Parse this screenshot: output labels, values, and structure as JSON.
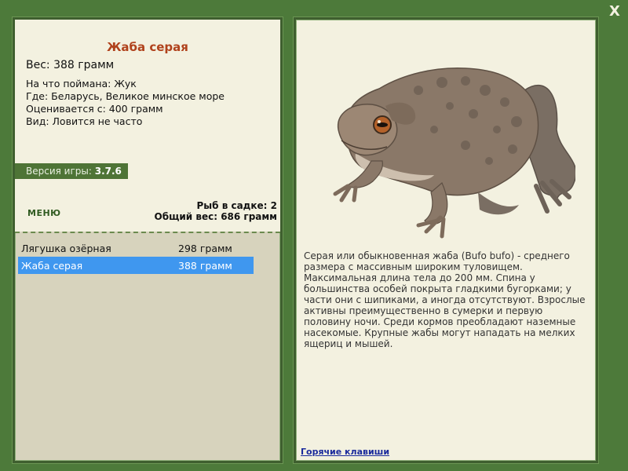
{
  "fish": {
    "title": "Жаба серая",
    "weight": "Вес: 388 грамм",
    "bait": "На что поймана: Жук",
    "location": "Где: Беларусь, Великое минское море",
    "value": "Оценивается с: 400 грамм",
    "rarity": "Вид: Ловится не часто"
  },
  "version": {
    "label": "Версия игры: ",
    "number": "3.7.6"
  },
  "menu": {
    "label": "МЕНЮ"
  },
  "cage": {
    "count": "Рыб в садке: 2",
    "total": "Общий вес: 686 грамм"
  },
  "catch_list": [
    {
      "name": "Лягушка озёрная",
      "weight": "298 грамм",
      "selected": false
    },
    {
      "name": "Жаба серая",
      "weight": "388 грамм",
      "selected": true
    }
  ],
  "description": "Серая или обыкновенная жаба (Bufo bufo) - среднего размера с массивным широким туловищем. Максимальная длина тела до 200 мм. Спина у большинства особей покрыта гладкими бугорками; у части они с шипиками, а иногда отсутствуют. Взрослые активны преимущественно в сумерки и первую половину ночи. Среди кормов преобладают наземные насекомые. Крупные жабы могут нападать на мелких ящериц и мышей.",
  "hotkeys": {
    "label": "Горячие клавиши"
  },
  "close": {
    "label": "X"
  },
  "colors": {
    "background": "#4d7a3a",
    "panel": "#f3f1e0",
    "title": "#b0421c",
    "selected_row": "#3f97ef"
  }
}
